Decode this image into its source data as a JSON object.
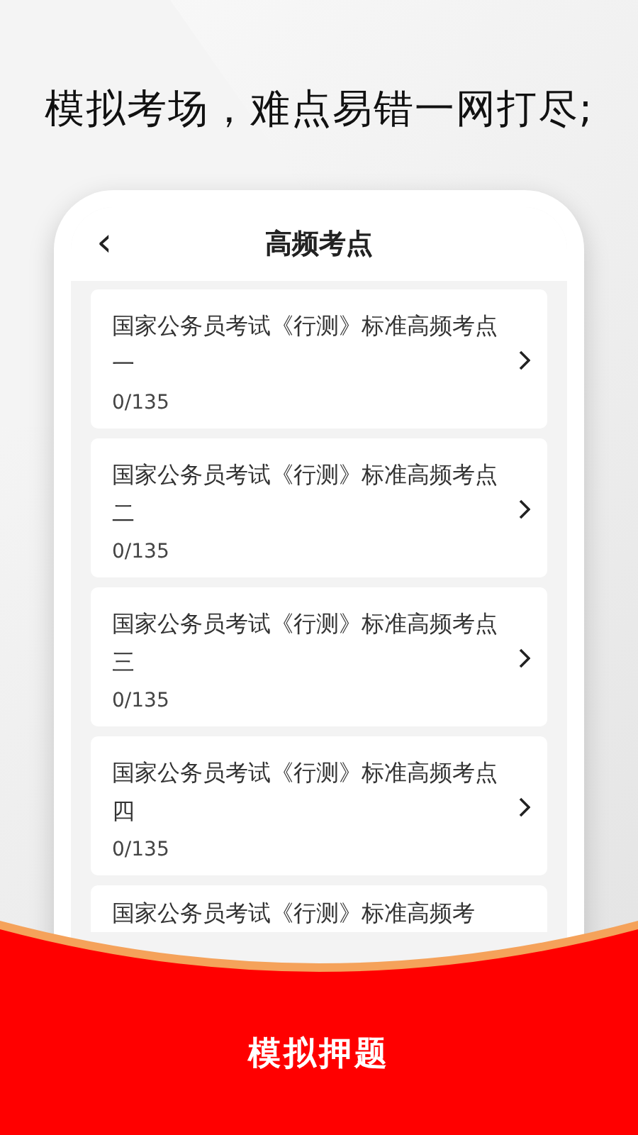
{
  "headline": "模拟考场，难点易错一网打尽;",
  "screen": {
    "back_icon": "‹",
    "title": "高频考点",
    "items": [
      {
        "title": "国家公务员考试《行测》标准高频考点一",
        "progress": "0/135"
      },
      {
        "title": "国家公务员考试《行测》标准高频考点二",
        "progress": "0/135"
      },
      {
        "title": "国家公务员考试《行测》标准高频考点三",
        "progress": "0/135"
      },
      {
        "title": "国家公务员考试《行测》标准高频考点四",
        "progress": "0/135"
      },
      {
        "title": "国家公务员考试《行测》标准高频考"
      }
    ]
  },
  "banner": "模拟押题"
}
